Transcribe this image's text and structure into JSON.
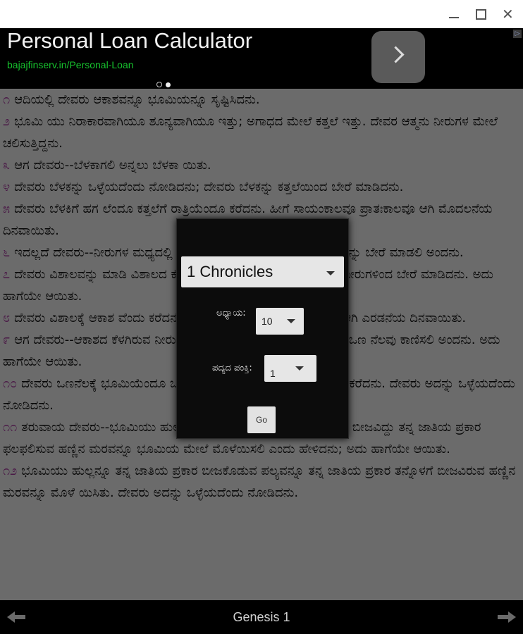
{
  "window": {
    "minimize_label": "",
    "maximize_label": "",
    "close_label": "✕"
  },
  "ad": {
    "title": "Personal Loan Calculator",
    "url": "bajajfinserv.in/Personal-Loan",
    "choices_label": "▷"
  },
  "verses": [
    {
      "num": "೧",
      "text": "ಆದಿಯಲ್ಲಿ ದೇವರು ಆಕಾಶವನ್ನೂ ಭೂಮಿಯನ್ನೂ ಸೃಷ್ಟಿಸಿದನು."
    },
    {
      "num": "೨",
      "text": "ಭೂಮಿ ಯು ನಿರಾಕಾರವಾಗಿಯೂ ಶೂನ್ಯವಾಗಿಯೂ ಇತ್ತು; ಅಗಾಧದ ಮೇಲೆ ಕತ್ತಲೆ ಇತ್ತು. ದೇವರ ಆತ್ಮನು ನೀರುಗಳ ಮೇಲೆ ಚಲಿಸುತ್ತಿದ್ದನು."
    },
    {
      "num": "೩",
      "text": "ಆಗ ದೇವರು--ಬೆಳಕಾಗಲಿ ಅನ್ನಲು ಬೆಳಕಾ ಯಿತು."
    },
    {
      "num": "೪",
      "text": "ದೇವರು ಬೆಳಕನ್ನು ಒಳ್ಳೆಯದೆಂದು ನೋಡಿದನು; ದೇವರು ಬೆಳಕನ್ನು ಕತ್ತಲೆಯಿಂದ ಬೇರೆ ಮಾಡಿದನು."
    },
    {
      "num": "೫",
      "text": "ದೇವರು ಬೆಳಕಿಗೆ ಹಗ ಲೆಂದೂ ಕತ್ತಲೆಗೆ ರಾತ್ರಿಯೆಂದೂ ಕರೆದನು. ಹೀಗೆ ಸಾಯಂಕಾಲವೂ ಪ್ರಾತಃಕಾಲವೂ ಆಗಿ ಮೊದಲನೆಯ ದಿನವಾಯಿತು."
    },
    {
      "num": "೬",
      "text": "ಇದಲ್ಲದೆ ದೇವರು--ನೀರುಗಳ ಮಧ್ಯದಲ್ಲಿ ವಿಶಾಲವಿರಲಿ; ಅದು ನೀರುಗಳಿಂದ ನೀರುಗಳನ್ನು ಬೇರೆ ಮಾಡಲಿ ಅಂದನು."
    },
    {
      "num": "೭",
      "text": "ದೇವರು ವಿಶಾಲವನ್ನು ಮಾಡಿ ವಿಶಾಲದ ಕೆಳಗಿರುವ ನೀರುಗಳನ್ನು ವಿಶಾಲದ ಮೇಲಿದ್ದ ನೀರುಗಳಿಂದ ಬೇರೆ ಮಾಡಿದನು. ಅದು ಹಾಗೆಯೇ ಆಯಿತು."
    },
    {
      "num": "೮",
      "text": "ದೇವರು ವಿಶಾಲಕ್ಕೆ ಆಕಾಶ ವೆಂದು ಕರೆದನು. ಹೀಗೆ ಸಾಯಂಕಾಲವೂ ಪ್ರಾತಃ ಕಾಲವೂ ಆಗಿ ಎರಡನೆಯ ದಿನವಾಯಿತು."
    },
    {
      "num": "೯",
      "text": "ಆಗ ದೇವರು--ಆಕಾಶದ ಕೆಳಗಿರುವ ನೀರುಗಳು ಒಂದು ಸ್ಥಳದಲ್ಲಿ ಕೂಡಿಕೊಳ್ಳಲಿ ಮತ್ತು ಒಣ ನೆಲವು ಕಾಣಿಸಲಿ ಅಂದನು. ಅದು ಹಾಗೆಯೇ ಆಯಿತು."
    },
    {
      "num": "೧೦",
      "text": "ದೇವರು ಒಣನೆಲಕ್ಕೆ ಭೂಮಿಯೆಂದೂ ಒಟ್ಟು ಗೂಡಿದ ನೀರುಗಳಿಗೆ ಸಮುದ್ರಗಳೆಂದೂ ಕರೆದನು. ದೇವರು ಅದನ್ನು ಒಳ್ಳೆಯದೆಂದು ನೋಡಿದನು."
    },
    {
      "num": "೧೧",
      "text": "ತರುವಾಯ ದೇವರು--ಭೂಮಿಯು ಹುಲ್ಲನ್ನೂ ಬೀಜಕೊಡುವ ಪಲ್ಯವನ್ನೂ ತನ್ನೊಳಗೆ ಬೀಜವಿದ್ದು ತನ್ನ ಜಾತಿಯ ಪ್ರಕಾರ ಫಲಫಲಿಸುವ ಹಣ್ಣಿನ ಮರವನ್ನೂ ಭೂಮಿಯ ಮೇಲೆ ಮೊಳೆಯಿಸಲಿ ಎಂದು ಹೇಳಿದನು; ಅದು ಹಾಗೆಯೇ ಆಯಿತು."
    },
    {
      "num": "೧೨",
      "text": "ಭೂಮಿಯು ಹುಲ್ಲನ್ನೂ ತನ್ನ ಜಾತಿಯ ಪ್ರಕಾರ ಬೀಜಕೊಡುವ ಪಲ್ಯವನ್ನೂ ತನ್ನ ಜಾತಿಯ ಪ್ರಕಾರ ತನ್ನೊಳಗೆ ಬೀಜವಿರುವ ಹಣ್ಣಿನ ಮರವನ್ನೂ ಮೊಳೆ ಯಿಸಿತು. ದೇವರು ಅದನ್ನು ಒಳ್ಳೆಯದೆಂದು ನೋಡಿದನು."
    }
  ],
  "dialog": {
    "book": "1 Chronicles",
    "chapter_label": "ಅಧ್ಯಾಯ:",
    "chapter_value": "10",
    "verse_label": "ಪದ್ಯದ ಪಂಕ್ತಿ:",
    "verse_value": "1",
    "go_label": "Go"
  },
  "bottom": {
    "title": "Genesis 1"
  },
  "colors": {
    "verse_number": "#b03aa8",
    "ad_url": "#17c32e"
  }
}
